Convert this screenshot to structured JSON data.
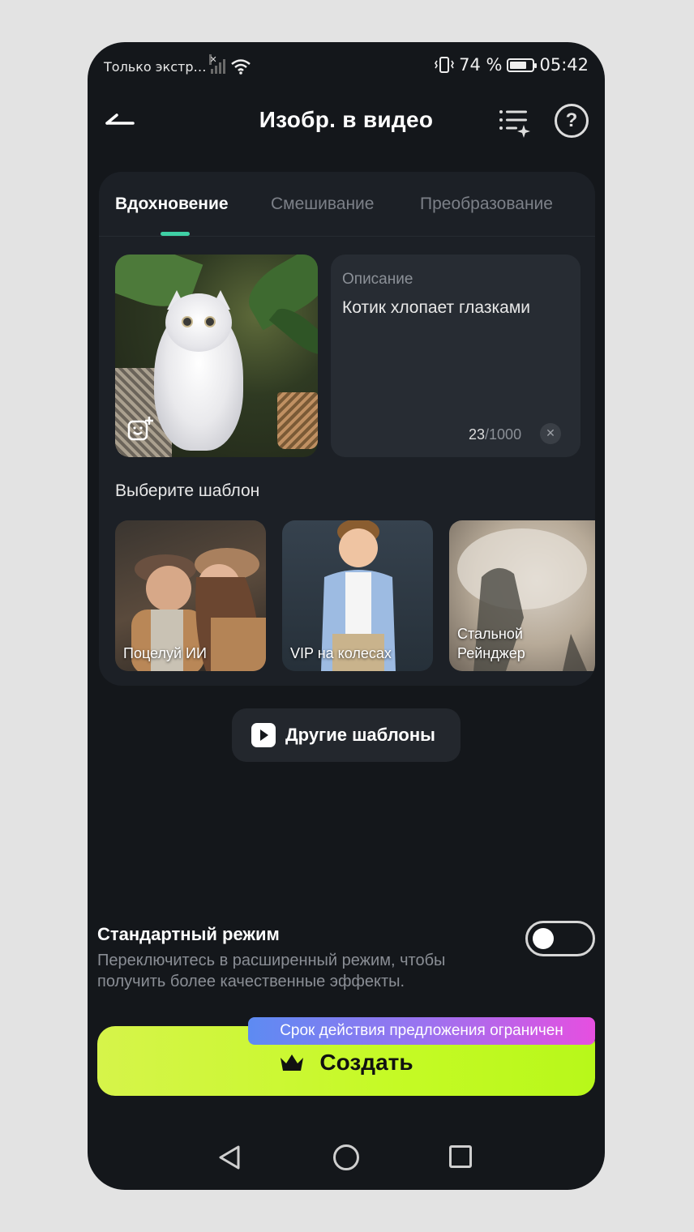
{
  "status_bar": {
    "carrier": "Только экстр…",
    "battery_percent": "74 %",
    "battery_level": 0.74,
    "time": "05:42"
  },
  "header": {
    "title": "Изобр. в видео"
  },
  "tabs": [
    {
      "label": "Вдохновение",
      "active": true
    },
    {
      "label": "Смешивание",
      "active": false
    },
    {
      "label": "Преобразование",
      "active": false
    }
  ],
  "description": {
    "label": "Описание",
    "text": "Котик хлопает глазками",
    "count_current": "23",
    "count_max": "/1000"
  },
  "templates": {
    "heading": "Выберите шаблон",
    "items": [
      {
        "label": "Поцелуй ИИ"
      },
      {
        "label": "VIP на колесах"
      },
      {
        "label": "Стальной Рейнджер"
      }
    ]
  },
  "other_templates_label": "Другие шаблоны",
  "mode": {
    "title": "Стандартный режим",
    "description": "Переключитесь в расширенный режим, чтобы получить более качественные эффекты.",
    "enabled": false
  },
  "create": {
    "label": "Создать",
    "promo": "Срок действия предложения ограничен"
  },
  "colors": {
    "accent": "#3fd0a5",
    "create_button": "#c5fa25",
    "background": "#14171b"
  }
}
